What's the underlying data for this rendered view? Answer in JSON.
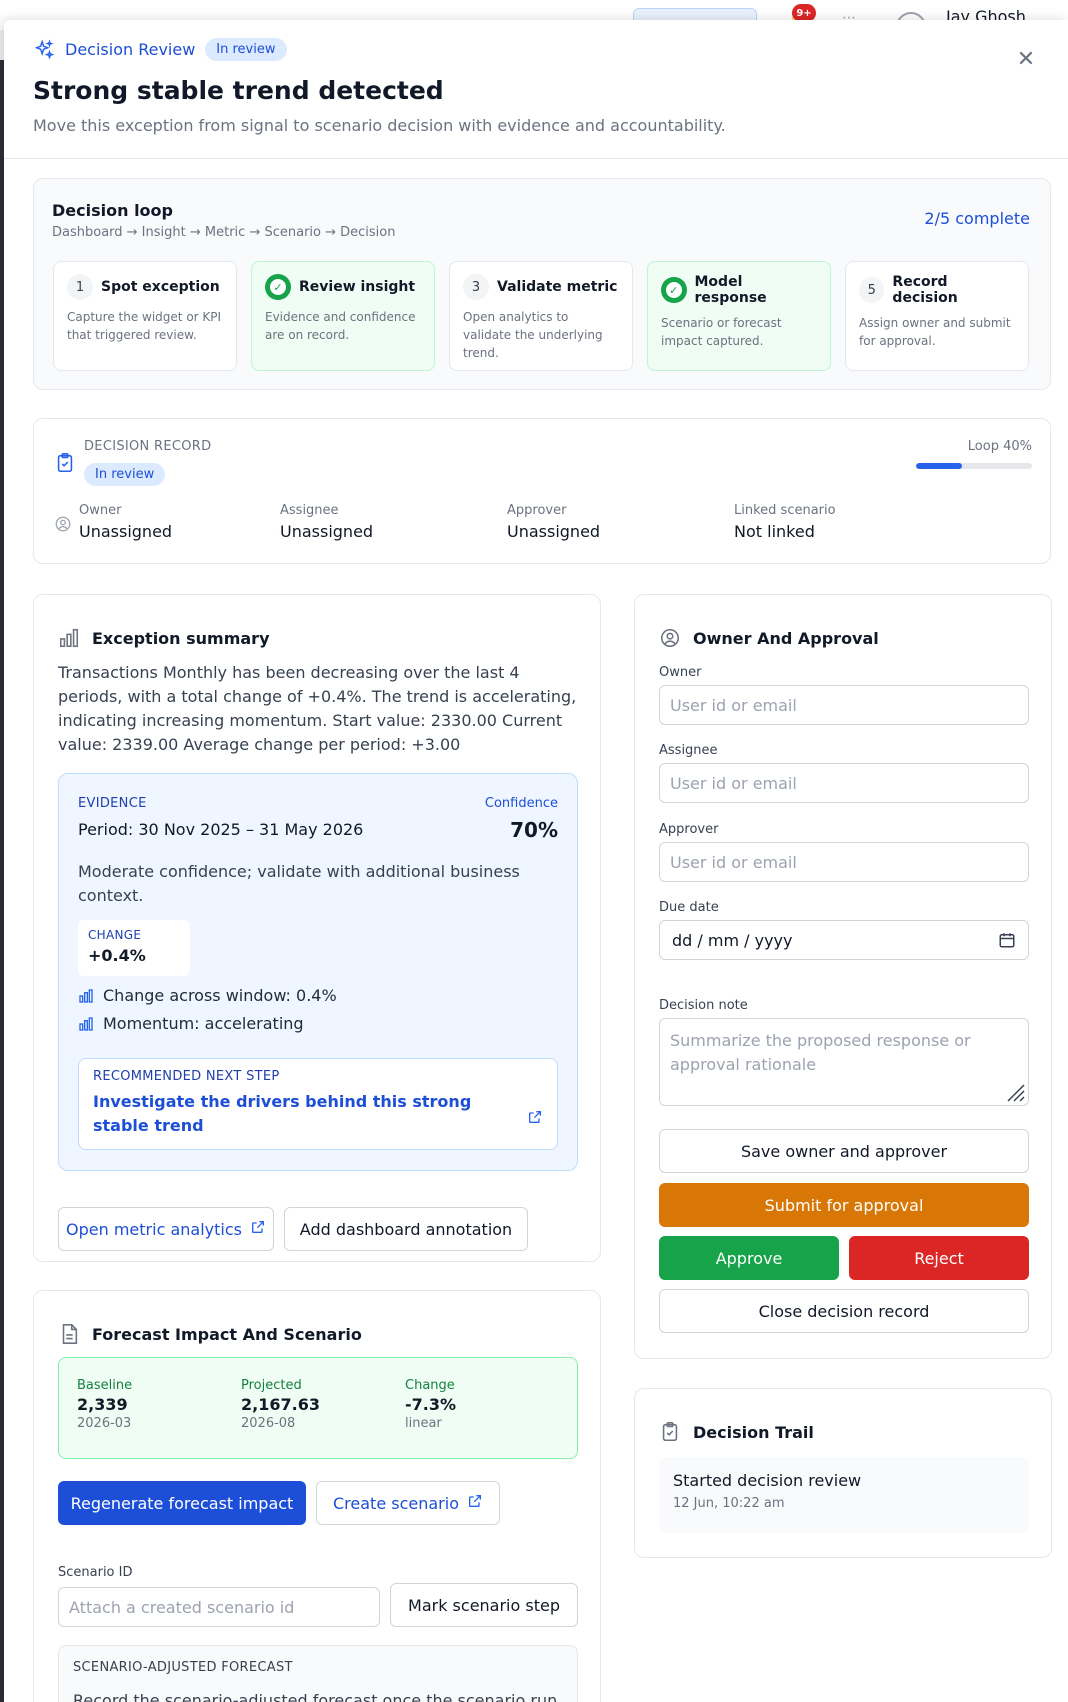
{
  "background": {
    "notifications_badge": "9+",
    "user_name": "Jay Ghosh"
  },
  "header": {
    "label": "Decision Review",
    "status": "In review",
    "title": "Strong stable trend detected",
    "subtitle": "Move this exception from signal to scenario decision with evidence and accountability."
  },
  "loop": {
    "title": "Decision loop",
    "breadcrumb": "Dashboard → Insight → Metric → Scenario → Decision",
    "progress": "2/5 complete",
    "steps": [
      {
        "num": "1",
        "title": "Spot exception",
        "desc": "Capture the widget or KPI that triggered review.",
        "done": false
      },
      {
        "num": "2",
        "title": "Review insight",
        "desc": "Evidence and confidence are on record.",
        "done": true
      },
      {
        "num": "3",
        "title": "Validate metric",
        "desc": "Open analytics to validate the underlying trend.",
        "done": false
      },
      {
        "num": "4",
        "title": "Model response",
        "desc": "Scenario or forecast impact captured.",
        "done": true
      },
      {
        "num": "5",
        "title": "Record decision",
        "desc": "Assign owner and submit for approval.",
        "done": false
      }
    ]
  },
  "record": {
    "label": "DECISION RECORD",
    "status": "In review",
    "loop_label": "Loop 40%",
    "loop_fraction": 0.4,
    "fields": [
      {
        "key": "Owner",
        "value": "Unassigned"
      },
      {
        "key": "Assignee",
        "value": "Unassigned"
      },
      {
        "key": "Approver",
        "value": "Unassigned"
      },
      {
        "key": "Linked scenario",
        "value": "Not linked"
      }
    ]
  },
  "exception": {
    "title": "Exception summary",
    "text": "Transactions Monthly has been decreasing over the last 4 periods, with a total change of +0.4%. The trend is accelerating, indicating increasing momentum. Start value: 2330.00 Current value: 2339.00 Average change per period: +3.00",
    "evidence": {
      "label": "EVIDENCE",
      "period_prefix": "Period: ",
      "period": "30 Nov 2025 – 31 May 2026",
      "confidence_label": "Confidence",
      "confidence": "70%",
      "note": "Moderate confidence; validate with additional business context.",
      "change_label": "CHANGE",
      "change_value": "+0.4%",
      "bullets": [
        "Change across window: 0.4%",
        "Momentum: accelerating"
      ],
      "next_label": "RECOMMENDED NEXT STEP",
      "next_text": "Investigate the drivers behind this strong stable trend"
    },
    "open_analytics": "Open metric analytics",
    "add_annotation": "Add dashboard annotation"
  },
  "forecast": {
    "title": "Forecast Impact And Scenario",
    "baseline_label": "Baseline",
    "baseline_value": "2,339",
    "baseline_sub": "2026-03",
    "projected_label": "Projected",
    "projected_value": "2,167.63",
    "projected_sub": "2026-08",
    "change_label": "Change",
    "change_value": "-7.3%",
    "change_sub": "linear",
    "regenerate": "Regenerate forecast impact",
    "create_scenario": "Create scenario",
    "scenario_id_label": "Scenario ID",
    "scenario_id_placeholder": "Attach a created scenario id",
    "mark_step": "Mark scenario step",
    "adjusted_label": "SCENARIO-ADJUSTED FORECAST",
    "adjusted_text": "Record the scenario-adjusted forecast once the scenario run"
  },
  "owner": {
    "title": "Owner And Approval",
    "owner_label": "Owner",
    "assignee_label": "Assignee",
    "approver_label": "Approver",
    "user_placeholder": "User id or email",
    "due_label": "Due date",
    "due_placeholder": "dd / mm / yyyy",
    "note_label": "Decision note",
    "note_placeholder": "Summarize the proposed response or approval rationale",
    "save": "Save owner and approver",
    "submit": "Submit for approval",
    "approve": "Approve",
    "reject": "Reject",
    "close_record": "Close decision record"
  },
  "trail": {
    "title": "Decision Trail",
    "items": [
      {
        "text": "Started decision review",
        "time": "12 Jun, 10:22 am"
      }
    ]
  }
}
